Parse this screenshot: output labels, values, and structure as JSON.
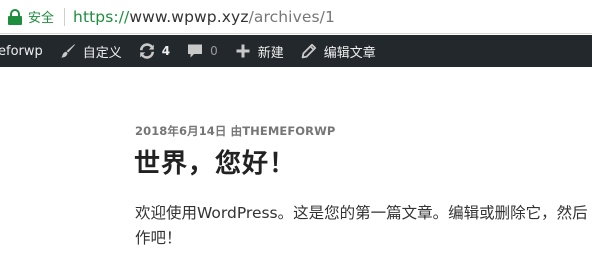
{
  "browser": {
    "secure_label": "安全",
    "url_scheme": "https://",
    "url_host": "www.wpwp.xyz",
    "url_path": "/archives/1"
  },
  "adminbar": {
    "site_name": "eforwp",
    "customize_label": "自定义",
    "updates_count": "4",
    "comments_count": "0",
    "new_label": "新建",
    "edit_label": "编辑文章"
  },
  "post": {
    "meta": "2018年6月14日 由THEMEFORWP",
    "title": "世界，您好！",
    "body_line1": "欢迎使用WordPress。这是您的第一篇文章。编辑或删除它，然后",
    "body_line2": "作吧！"
  }
}
